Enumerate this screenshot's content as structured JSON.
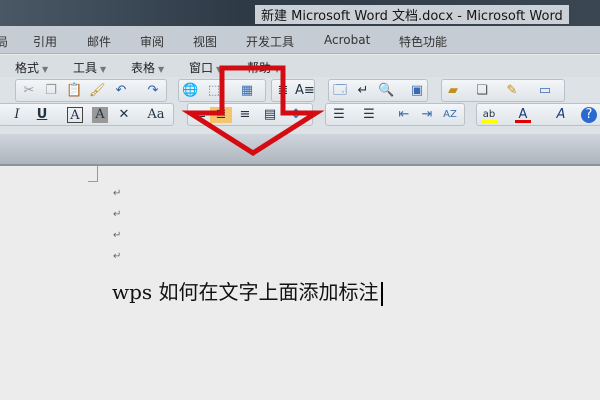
{
  "window": {
    "title": "新建 Microsoft Word 文档.docx - Microsoft Word"
  },
  "ribbon_tabs": [
    "局",
    "引用",
    "邮件",
    "审阅",
    "视图",
    "开发工具",
    "Acrobat",
    "特色功能"
  ],
  "menu": [
    "格式",
    "工具",
    "表格",
    "窗口",
    "帮助"
  ],
  "document": {
    "pilcrow": "↵",
    "text": "wps 如何在文字上面添加标注"
  },
  "colors": {
    "arrow": "#d40c12",
    "highlight": "#ffff00",
    "font_color": "#e00000"
  }
}
